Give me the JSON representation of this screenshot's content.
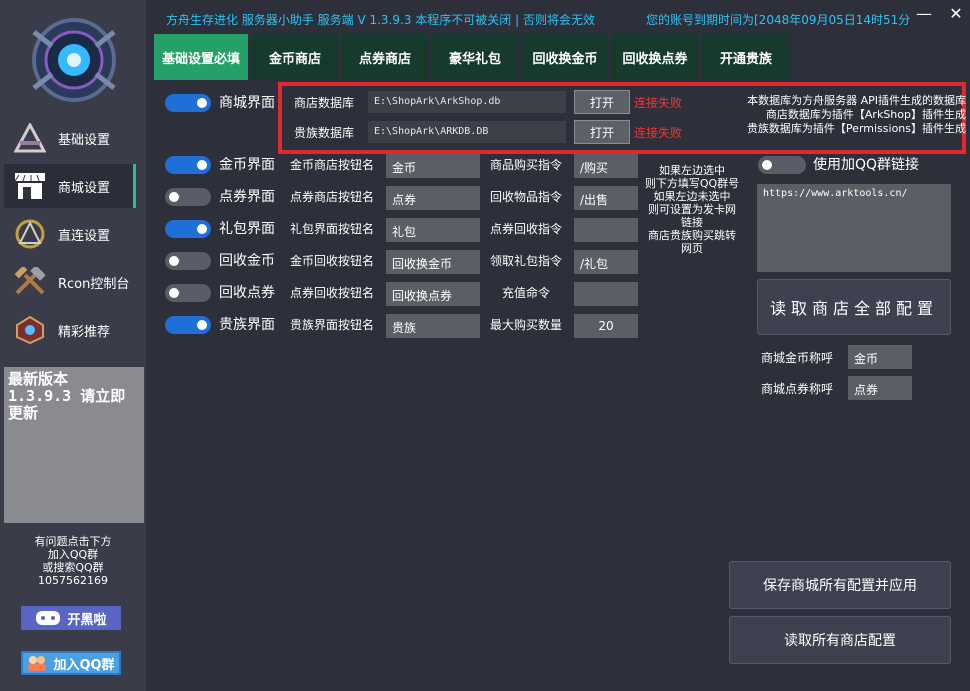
{
  "titlebar": {
    "title": "方舟生存进化  服务器小助手  服务端 V 1.3.9.3 本程序不可被关闭 | 否则将会无效",
    "expiry": "您的账号到期时间为[2048年09月05日14时51分",
    "min": "—",
    "close": "✕"
  },
  "sidebar": {
    "items": [
      {
        "label": "基础设置",
        "icon": "ark-logo-icon"
      },
      {
        "label": "商城设置",
        "icon": "shop-icon"
      },
      {
        "label": "直连设置",
        "icon": "ark-logo-icon"
      },
      {
        "label": "Rcon控制台",
        "icon": "hammer-icon"
      },
      {
        "label": "精彩推荐",
        "icon": "badge-icon"
      }
    ],
    "notice": "最新版本 1.3.9.3 请立即更新",
    "help": [
      "有问题点击下方",
      "加入QQ群",
      "或搜索QQ群",
      "1057562169"
    ],
    "badge1": "开黑啦",
    "badge2": "加入QQ群"
  },
  "tabs": [
    "基础设置必填",
    "金币商店",
    "点券商店",
    "豪华礼包",
    "回收换金币",
    "回收换点券",
    "开通贵族"
  ],
  "db": {
    "shop_label": "商店数据库",
    "shop_path": "E:\\ShopArk\\ArkShop.db",
    "noble_label": "贵族数据库",
    "noble_path": "E:\\ShopArk\\ARKDB.DB",
    "open": "打开",
    "fail": "连接失败",
    "note": [
      "本数据库为方舟服务器 API插件生成的数据库",
      "商店数据库为插件【ArkShop】插件生成",
      "贵族数据库为插件【Permissions】插件生成"
    ]
  },
  "sections": [
    {
      "label": "商城界面",
      "on": true
    },
    {
      "label": "金币界面",
      "on": true
    },
    {
      "label": "点券界面",
      "on": false
    },
    {
      "label": "礼包界面",
      "on": true
    },
    {
      "label": "回收金币",
      "on": false
    },
    {
      "label": "回收点券",
      "on": false
    },
    {
      "label": "贵族界面",
      "on": true
    }
  ],
  "buttons": [
    {
      "label": "金币商店按钮名",
      "value": "金币"
    },
    {
      "label": "点券商店按钮名",
      "value": "点券"
    },
    {
      "label": "礼包界面按钮名",
      "value": "礼包"
    },
    {
      "label": "金币回收按钮名",
      "value": "回收换金币"
    },
    {
      "label": "点券回收按钮名",
      "value": "回收换点券"
    },
    {
      "label": "贵族界面按钮名",
      "value": "贵族"
    }
  ],
  "commands": [
    {
      "label": "商品购买指令",
      "value": "/购买"
    },
    {
      "label": "回收物品指令",
      "value": "/出售"
    },
    {
      "label": "点券回收指令",
      "value": ""
    },
    {
      "label": "领取礼包指令",
      "value": "/礼包"
    },
    {
      "label": "充值命令",
      "value": ""
    },
    {
      "label": "最大购买数量",
      "value": "20"
    }
  ],
  "hint": [
    "如果左边选中",
    "则下方填写QQ群号",
    "如果左边未选中",
    "则可设置为发卡网",
    "链接",
    "商店贵族购买跳转",
    "网页"
  ],
  "qq_link": {
    "label": "使用加QQ群链接",
    "url": "https://www.arktools.cn/"
  },
  "right": {
    "read_all": "读取商店全部配置",
    "gold_name_label": "商城金币称呼",
    "gold_name": "金币",
    "point_name_label": "商城点券称呼",
    "point_name": "点券",
    "save": "保存商城所有配置并应用",
    "read_shop": "读取所有商店配置"
  },
  "colors": {
    "accent": "#24a068",
    "tab": "#163a2c",
    "toggle_on": "#1f6fd6",
    "error": "#ff3030",
    "title": "#2bc3f2"
  }
}
